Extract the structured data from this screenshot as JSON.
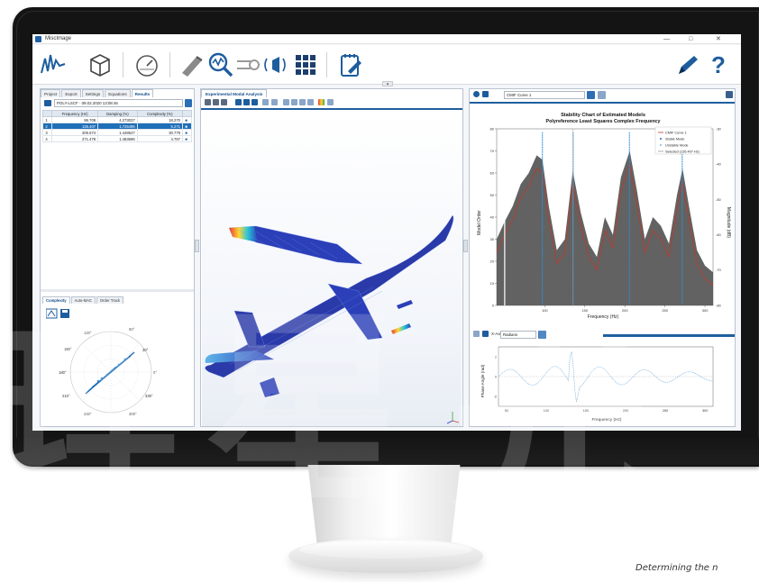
{
  "window": {
    "title": "MiscImage",
    "controls": [
      "—",
      "□",
      "✕"
    ]
  },
  "ribbon": {
    "buttons": [
      {
        "name": "signal-processing-icon"
      },
      {
        "name": "geometry-cube-icon"
      },
      {
        "name": "gauge-icon"
      },
      {
        "name": "pen-sheet-icon"
      },
      {
        "name": "magnify-waveform-icon"
      },
      {
        "name": "sensor-icon"
      },
      {
        "name": "shaker-icon"
      },
      {
        "name": "grid-icon"
      },
      {
        "name": "report-icon"
      }
    ],
    "right_buttons": [
      {
        "name": "pencil-icon"
      },
      {
        "name": "help-icon",
        "label": "?"
      }
    ]
  },
  "left_panel": {
    "tabs": [
      "Project",
      "Export",
      "Settings",
      "Equations",
      "Results"
    ],
    "active_tab": "Results",
    "dataset": "POLY-LSCF · 09.02.2020 13:08:46",
    "modes_table": {
      "columns": [
        "",
        "Frequency (Hz)",
        "Damping (%)",
        "Complexity (%)",
        ""
      ],
      "rows": [
        [
          "1",
          "96.709",
          "4.273037",
          "18.270",
          "■"
        ],
        [
          "2",
          "135.407",
          "1.725495",
          "5.271",
          "■"
        ],
        [
          "3",
          "205.674",
          "1.448547",
          "30.779",
          "■"
        ],
        [
          "4",
          "271.478",
          "1.483696",
          "4.767",
          "■"
        ]
      ],
      "selected_row": 1
    },
    "lower_tabs": [
      "Complexity",
      "Auto-MAC",
      "Order Track"
    ],
    "polar_labels": [
      "30°",
      "60°",
      "120°",
      "150°",
      "180°",
      "210°",
      "240°",
      "300°",
      "330°",
      "0°"
    ]
  },
  "center_panel": {
    "tab": "Experimental Modal Analysis"
  },
  "right_panel": {
    "curve_select": "CMIF Curve 1",
    "stability_chart": {
      "title": "Stability Chart of Estimated Models",
      "subtitle": "Polyreference Least Squares Complex Frequency",
      "xlabel": "Frequency (Hz)",
      "ylabel_left": "Model Order",
      "ylabel_right": "Magnitude (dB)",
      "legend": [
        "CMIF Curve 1",
        "Stable Mode",
        "Unstable Mode",
        "Selected (135.407 Hz)"
      ]
    },
    "x_axis_label": "X-Axis",
    "x_axis_value": "Radians",
    "phase_chart": {
      "xlabel": "Frequency (Hz)",
      "ylabel": "Phase Angle (rad)"
    }
  },
  "chart_data": {
    "type": "line",
    "title": "Stability Chart of Estimated Models",
    "subtitle": "Polyreference Least Squares Complex Frequency",
    "xlabel": "Frequency (Hz)",
    "ylabel": "Model Order",
    "y2label": "Magnitude (dB)",
    "xlim": [
      40,
      310
    ],
    "ylim": [
      0,
      80
    ],
    "x_ticks": [
      100,
      150,
      200,
      250,
      300
    ],
    "y_ticks": [
      0,
      10,
      20,
      30,
      40,
      50,
      60,
      70,
      80
    ],
    "y2_ticks": [
      -80,
      -70,
      -60,
      -50,
      -40,
      -30
    ],
    "series": [
      {
        "name": "CMIF Curve 1",
        "x": [
          40,
          50,
          60,
          70,
          80,
          90,
          97,
          105,
          115,
          125,
          135,
          145,
          155,
          165,
          175,
          185,
          195,
          206,
          215,
          225,
          235,
          245,
          255,
          265,
          272,
          280,
          290,
          300,
          310
        ],
        "values": [
          30,
          38,
          45,
          55,
          60,
          68,
          66,
          45,
          25,
          30,
          61,
          42,
          28,
          22,
          40,
          32,
          58,
          70,
          52,
          30,
          40,
          36,
          28,
          50,
          62,
          45,
          25,
          18,
          15
        ]
      }
    ],
    "stable_modes_hz": [
      97,
      135.4,
      205.7,
      271.5
    ],
    "selected_hz": 135.407,
    "legend_position": "top-right",
    "grid": false
  },
  "phase_data": {
    "type": "line",
    "xlabel": "Frequency (Hz)",
    "ylabel": "Phase Angle (rad)",
    "xlim": [
      40,
      310
    ],
    "ylim": [
      -3,
      3
    ],
    "x_ticks": [
      50,
      100,
      150,
      200,
      250,
      300
    ],
    "y_ticks": [
      -2,
      0,
      2
    ]
  },
  "caption": "Determining the n",
  "watermark": [
    "理",
    "星",
    "光"
  ],
  "colors": {
    "accent": "#1f5f9f",
    "selection": "#1f6fb8",
    "plane": "#2b3fb8",
    "plot_fill": "#555555",
    "cmif_line": "#c0392b"
  }
}
